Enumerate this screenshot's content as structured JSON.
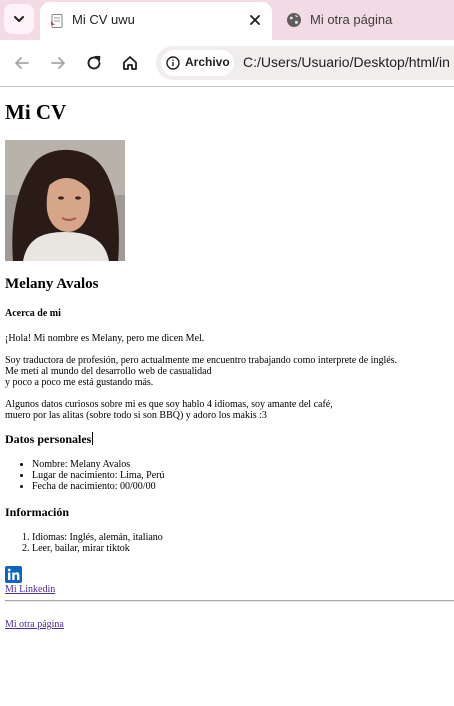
{
  "browser": {
    "tabs": [
      {
        "title": "Mi CV uwu",
        "active": true
      },
      {
        "title": "Mi otra página",
        "active": false
      }
    ],
    "security_chip": "Archivo",
    "url": "C:/Users/Usuario/Desktop/html/in"
  },
  "page": {
    "heading": "Mi CV",
    "name": "Melany Avalos",
    "about_title": "Acerca de mi",
    "greeting": "¡Hola! Mi nombre es Melany, pero me dicen Mel.",
    "bio_lines": [
      "Soy traductora de profesión, pero actualmente me encuentro trabajando como interprete de inglés.",
      "Me metí al mundo del desarrollo web de casualidad",
      "y poco a poco me está gustando más."
    ],
    "facts_lines": [
      "Algunos datos curiosos sobre mi es que soy hablo 4 idiomas, soy amante del café,",
      "muero por las alitas (sobre todo si son BBQ) y adoro los makis :3"
    ],
    "personal_title": "Datos personales",
    "personal_items": [
      "Nombre: Melany Avalos",
      "Lugar de nacimiento: Lima, Perú",
      "Fecha de nacimiento: 00/00/00"
    ],
    "info_title": "Información",
    "info_items": [
      "Idiomas: Inglés, alemán, italiano",
      "Leer, bailar, mirar tiktok"
    ],
    "linkedin_link": "Mi Linkedin",
    "other_page_link": "Mi otra página"
  },
  "colors": {
    "tabbar_bg": "#f3dbe6",
    "link_visited": "#4f2aa3",
    "linkedin_blue": "#0a66c2"
  }
}
